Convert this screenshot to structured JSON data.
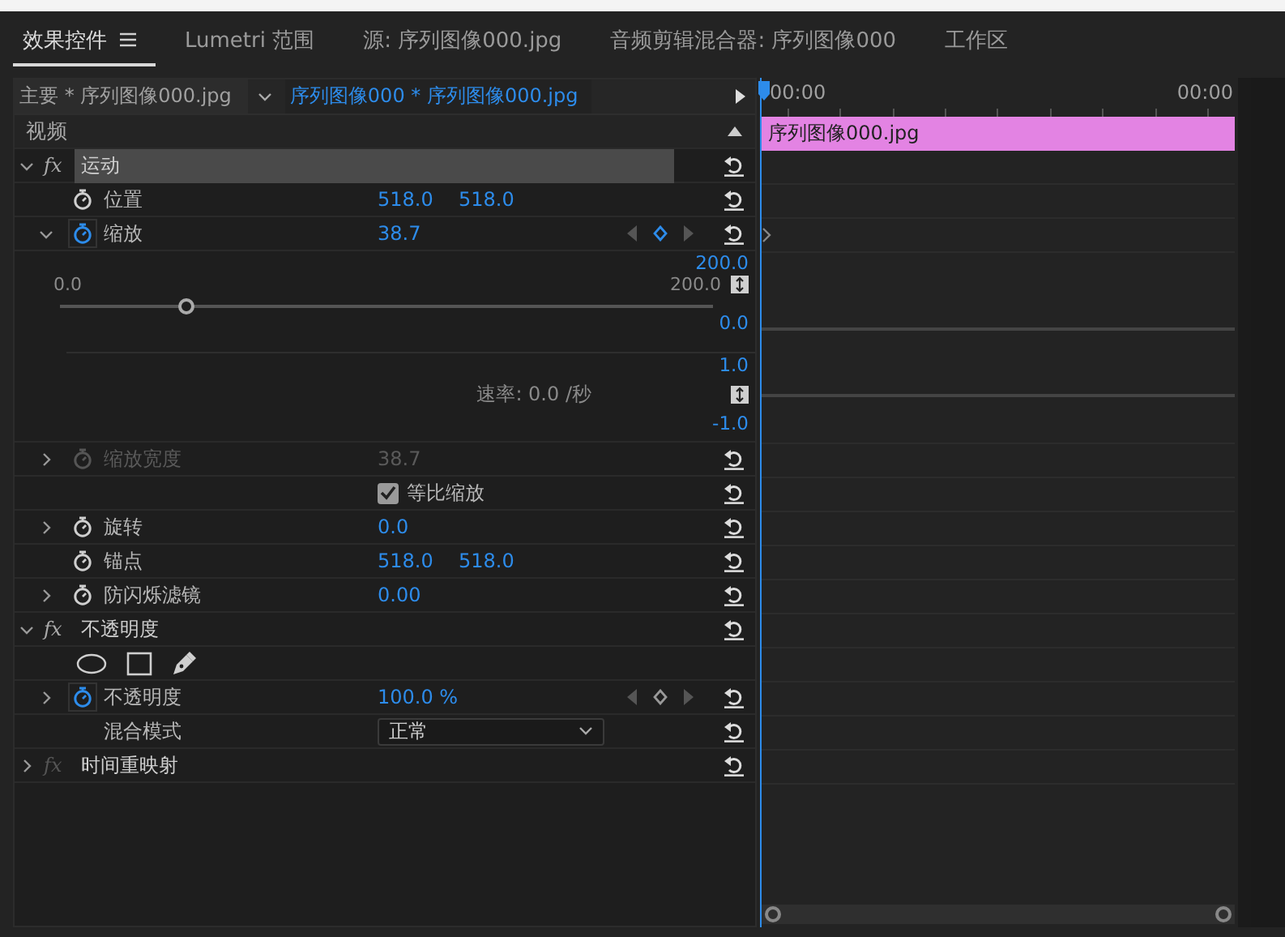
{
  "tabs": [
    {
      "label": "效果控件",
      "selected": true
    },
    {
      "label": "Lumetri 范围",
      "selected": false
    },
    {
      "label": "源: 序列图像000.jpg",
      "selected": false
    },
    {
      "label": "音频剪辑混合器: 序列图像000",
      "selected": false
    },
    {
      "label": "工作区",
      "selected": false
    }
  ],
  "sequence_bar": {
    "master": "主要 * 序列图像000.jpg",
    "clip": "序列图像000 * 序列图像000.jpg"
  },
  "timeline": {
    "start_time": "00:00",
    "end_time": "00:00",
    "clip_label": "序列图像000.jpg"
  },
  "section": {
    "label": "视频",
    "expanded": true
  },
  "rows": [
    {
      "kind": "effect",
      "fx_label": "fx",
      "name": "运动",
      "expanded": true,
      "selected": true,
      "enabled": true
    },
    {
      "kind": "property",
      "name": "位置",
      "animated": false,
      "disabled": false,
      "values": [
        "518.0",
        "518.0"
      ],
      "timeline_keyframe": false
    },
    {
      "kind": "property",
      "name": "缩放",
      "expanded": true,
      "animated": true,
      "disabled": false,
      "values": [
        "38.7"
      ],
      "keyframe_nav": {
        "on_keyframe": true
      },
      "timeline_keyframe": true
    },
    {
      "kind": "graph",
      "value_max": "200.0",
      "value_min": "0.0",
      "slider_min": "0.0",
      "slider_max": "200.0",
      "level": 0.1935,
      "velocity_max": "1.0",
      "velocity_min": "-1.0",
      "rate": "速率: 0.0 /秒"
    },
    {
      "kind": "property",
      "name": "缩放宽度",
      "expanded": false,
      "animated": false,
      "disabled": true,
      "values": [
        "38.7"
      ],
      "timeline_keyframe": false
    },
    {
      "kind": "checkbox",
      "label": "等比缩放",
      "checked": true
    },
    {
      "kind": "property",
      "name": "旋转",
      "expanded": false,
      "animated": false,
      "disabled": false,
      "values": [
        "0.0"
      ],
      "timeline_keyframe": false
    },
    {
      "kind": "property",
      "name": "锚点",
      "animated": false,
      "disabled": false,
      "values": [
        "518.0",
        "518.0"
      ],
      "timeline_keyframe": false
    },
    {
      "kind": "property",
      "name": "防闪烁滤镜",
      "expanded": false,
      "animated": false,
      "disabled": false,
      "values": [
        "0.00"
      ],
      "timeline_keyframe": false
    },
    {
      "kind": "effect",
      "fx_label": "fx",
      "name": "不透明度",
      "expanded": true,
      "selected": false,
      "enabled": true
    },
    {
      "kind": "masks"
    },
    {
      "kind": "property",
      "name": "不透明度",
      "expanded": false,
      "animated": true,
      "disabled": false,
      "values": [
        "100.0 %"
      ],
      "keyframe_nav": {
        "on_keyframe": false
      },
      "timeline_keyframe": false
    },
    {
      "kind": "dropdown",
      "name": "混合模式",
      "value": "正常"
    },
    {
      "kind": "effect",
      "fx_label": "fx",
      "name": "时间重映射",
      "expanded": false,
      "selected": false,
      "enabled": false
    }
  ]
}
